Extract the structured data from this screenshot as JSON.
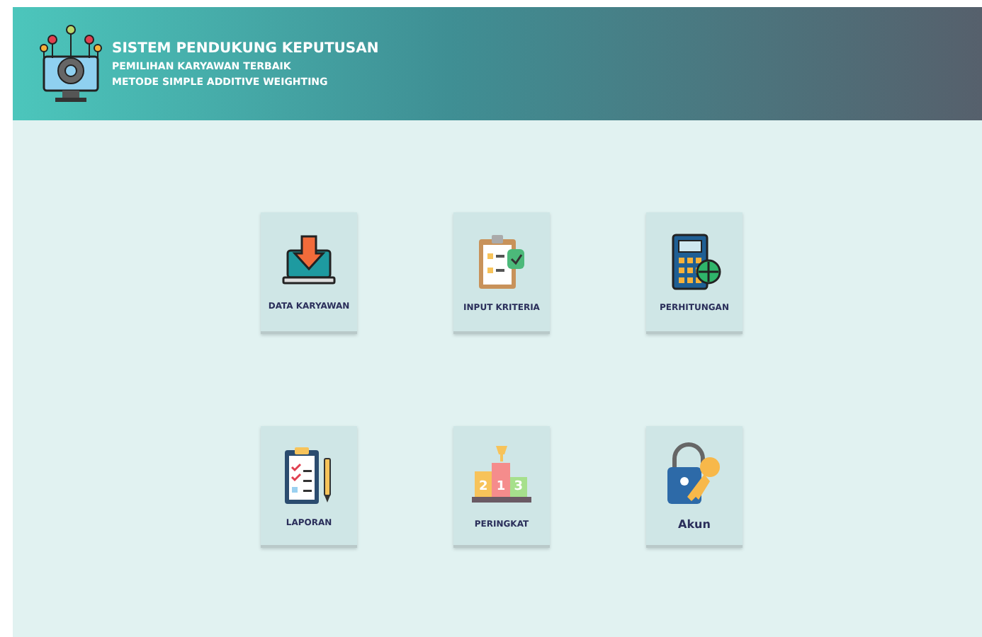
{
  "header": {
    "title": "SISTEM PENDUKUNG KEPUTUSAN",
    "subtitle": "PEMILIHAN KARYAWAN TERBAIK",
    "method": "METODE SIMPLE ADDITIVE WEIGHTING"
  },
  "menu": [
    {
      "kind": "download",
      "label": "DATA KARYAWAN"
    },
    {
      "kind": "clipboard",
      "label": "INPUT KRITERIA"
    },
    {
      "kind": "calculator",
      "label": "PERHITUNGAN"
    },
    {
      "kind": "report",
      "label": "LAPORAN"
    },
    {
      "kind": "podium",
      "label": "PERINGKAT",
      "places": [
        "2",
        "1",
        "3"
      ]
    },
    {
      "kind": "lock",
      "label": "Akun"
    }
  ]
}
